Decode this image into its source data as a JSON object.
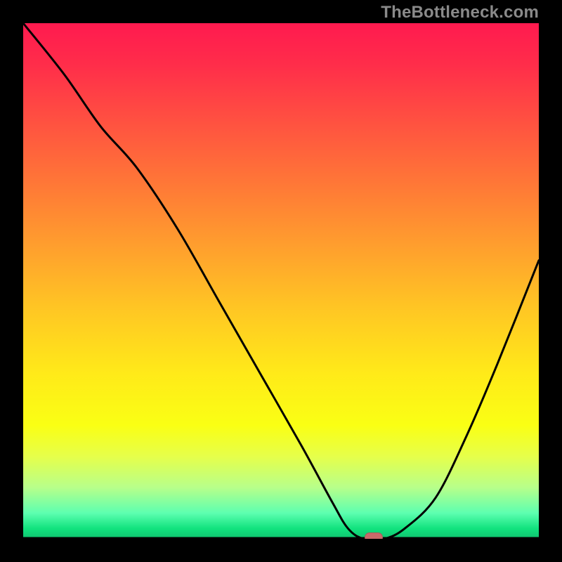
{
  "watermark": "TheBottleneck.com",
  "chart_data": {
    "type": "line",
    "title": "",
    "xlabel": "",
    "ylabel": "",
    "xlim": [
      0,
      100
    ],
    "ylim": [
      0,
      100
    ],
    "x": [
      0,
      8,
      15,
      22,
      30,
      38,
      46,
      54,
      60,
      63,
      66,
      70,
      74,
      80,
      86,
      92,
      100
    ],
    "values": [
      100,
      90,
      80,
      72,
      60,
      46,
      32,
      18,
      7,
      2,
      0,
      0,
      2,
      8,
      20,
      34,
      54
    ],
    "marker": {
      "x": 68,
      "y": 0
    },
    "gradient_colors": [
      "#ff1a4f",
      "#ffea19",
      "#0fc46f"
    ]
  }
}
